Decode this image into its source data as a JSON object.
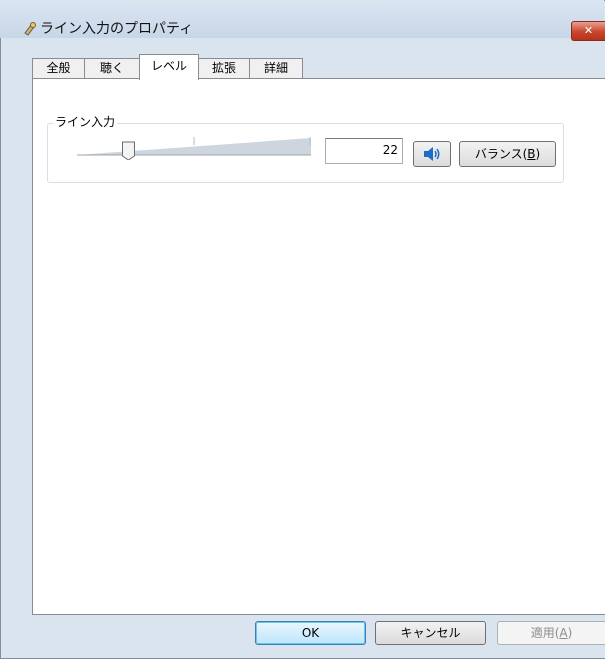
{
  "window": {
    "title": "ライン入力のプロパティ",
    "close_glyph": "✕"
  },
  "tabs": [
    {
      "label": "全般",
      "active": false
    },
    {
      "label": "聴く",
      "active": false
    },
    {
      "label": "レベル",
      "active": true
    },
    {
      "label": "拡張",
      "active": false
    },
    {
      "label": "詳細",
      "active": false
    }
  ],
  "level": {
    "group_label": "ライン入力",
    "value": "22",
    "slider_fraction": 0.22,
    "balance_label": "バランス(",
    "balance_key": "B",
    "balance_suffix": ")"
  },
  "buttons": {
    "ok": "OK",
    "cancel": "キャンセル",
    "apply_label": "適用(",
    "apply_key": "A",
    "apply_suffix": ")"
  },
  "colors": {
    "accent": "#3c7fb1",
    "close": "#c9452c",
    "speaker": "#1e6cc8"
  },
  "icons": {
    "title": "audio-device-icon",
    "mute": "speaker-icon"
  }
}
